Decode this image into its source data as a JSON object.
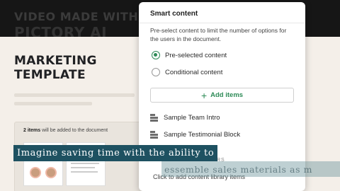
{
  "background": {
    "watermark_line1": "VIDEO MADE WITH",
    "watermark_line2": "PICTORY AI"
  },
  "template": {
    "title_line1": "MARKETING",
    "title_line2": "TEMPLATE",
    "doc_card": {
      "count_bold": "2 items",
      "count_rest": " will be added to the document"
    }
  },
  "popup": {
    "title": "Smart content",
    "description": "Pre-select content to limit the number of options for the users in the document.",
    "options": [
      {
        "label": "Pre-selected content",
        "selected": true
      },
      {
        "label": "Conditional content",
        "selected": false
      }
    ],
    "add_items_label": "Add items",
    "items": [
      {
        "label": "Sample Team Intro",
        "icon": "team-document-icon"
      },
      {
        "label": "Sample Testimonial Block",
        "icon": "testimonial-document-icon"
      }
    ],
    "library_section_partial": "RS",
    "library_link": "Click to add content library items"
  },
  "captions": {
    "main": "Imagine saving time with the ability to",
    "ghost": "essemble sales materials as m"
  },
  "colors": {
    "accent": "#2e8b57",
    "caption_bg": "#1e5161",
    "panel_bg": "#f4efe9"
  }
}
